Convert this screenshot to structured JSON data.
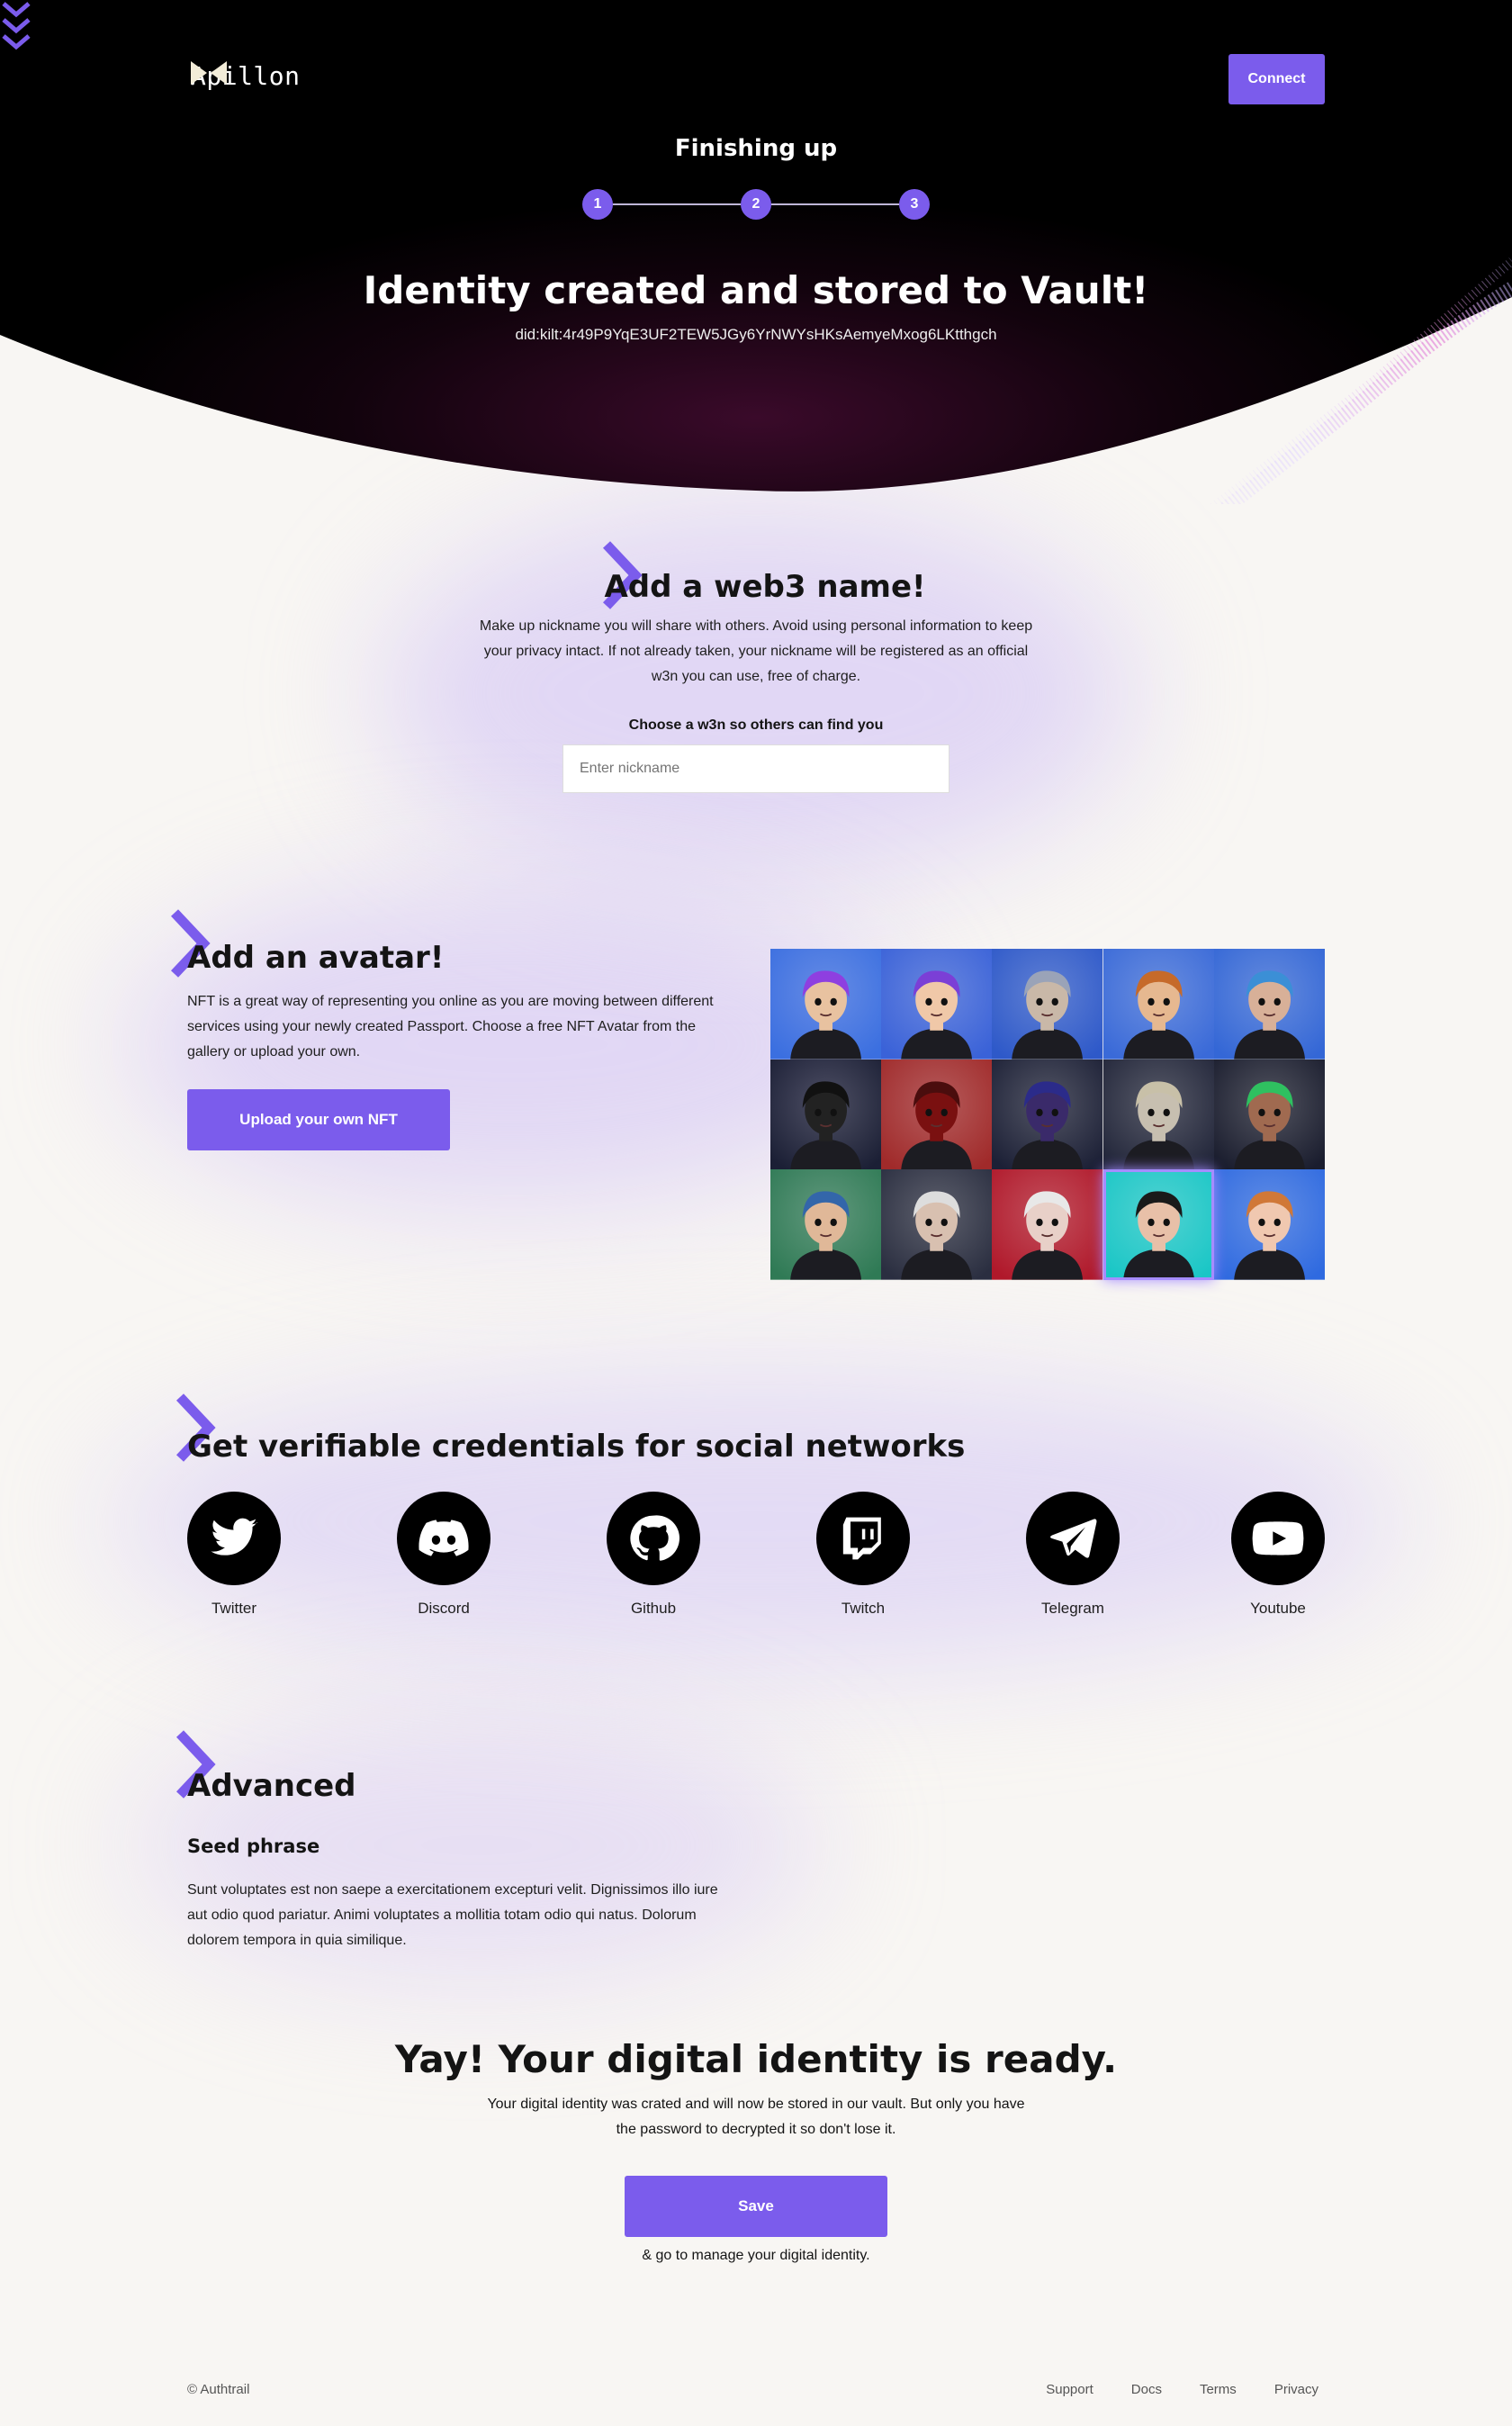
{
  "brand": {
    "name": "Apillon"
  },
  "header": {
    "connect_label": "Connect"
  },
  "progress": {
    "title": "Finishing up",
    "steps": [
      "1",
      "2",
      "3"
    ]
  },
  "hero": {
    "title": "Identity created and stored to Vault!",
    "did": "did:kilt:4r49P9YqE3UF2TEW5JGy6YrNWYsHKsAemyeMxog6LKtthgch"
  },
  "web3name": {
    "title": "Add a web3 name!",
    "description": "Make up nickname you will share with others. Avoid using personal information to keep your privacy intact. If not already taken, your nickname will be registered as an official w3n you can use, free of charge.",
    "input_label": "Choose a w3n so others can find you",
    "input_placeholder": "Enter nickname",
    "input_value": ""
  },
  "avatar": {
    "title": "Add an avatar!",
    "description": "NFT is a great way of representing you online as you are moving between different services using your newly created Passport. Choose a free NFT Avatar from the gallery or upload your own.",
    "upload_label": "Upload your own NFT",
    "selected_index": 13
  },
  "credentials": {
    "title": "Get verifiable credentials for social networks",
    "networks": [
      {
        "label": "Twitter",
        "icon": "twitter-icon"
      },
      {
        "label": "Discord",
        "icon": "discord-icon"
      },
      {
        "label": "Github",
        "icon": "github-icon"
      },
      {
        "label": "Twitch",
        "icon": "twitch-icon"
      },
      {
        "label": "Telegram",
        "icon": "telegram-icon"
      },
      {
        "label": "Youtube",
        "icon": "youtube-icon"
      }
    ]
  },
  "advanced": {
    "title": "Advanced",
    "seed_title": "Seed phrase",
    "seed_text": "Sunt voluptates est non saepe a exercitationem excepturi velit. Dignissimos illo iure aut odio quod pariatur. Animi voluptates a mollitia totam odio qui natus. Dolorum dolorem tempora in quia similique."
  },
  "final": {
    "title": "Yay! Your digital identity is ready.",
    "text": "Your digital identity was crated and will now be stored in our vault. But only you have the password to decrypted it so don't lose it.",
    "save_label": "Save",
    "save_note": "& go to manage your digital identity."
  },
  "footer": {
    "copyright": "© Authtrail",
    "links": [
      "Support",
      "Docs",
      "Terms",
      "Privacy"
    ]
  },
  "colors": {
    "accent": "#7b5cec",
    "hero_bg": "#000000",
    "page_bg": "#f8f6f3"
  }
}
